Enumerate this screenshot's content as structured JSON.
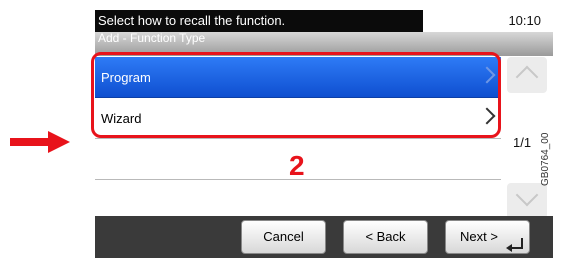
{
  "status_bar": {
    "message": "Select how to recall the function.",
    "time": "10:10"
  },
  "subtitle": "Add - Function Type",
  "list": {
    "items": [
      {
        "label": "Program",
        "selected": true
      },
      {
        "label": "Wizard",
        "selected": false
      }
    ]
  },
  "pagination": {
    "indicator": "1/1"
  },
  "buttons": {
    "cancel": "Cancel",
    "back": "< Back",
    "next": "Next >"
  },
  "annotation": {
    "step": "2",
    "figure_code": "GB0764_00"
  },
  "colors": {
    "selected_row": "#1e63e6",
    "highlight": "#e8131b",
    "pointer_arrow": "#e8131b"
  },
  "icons": {
    "scroll_up": "chevron-up-icon",
    "scroll_down": "chevron-down-icon",
    "row_arrow": "chevron-right-icon",
    "enter": "enter-icon"
  }
}
